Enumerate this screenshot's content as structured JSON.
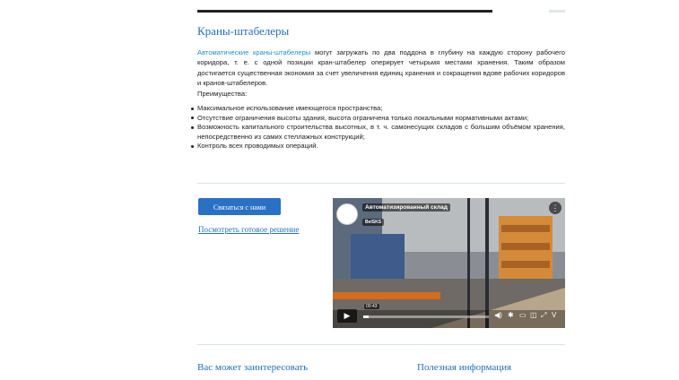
{
  "section": {
    "title": "Краны-штабелеры",
    "intro_link": "Автоматические краны-штабелеры",
    "intro_text": " могут загружать по два поддона в глубину на каждую сторону рабочего коридора, т. е. с одной позиции кран-штабелер оперирует четырьмя местами хранения. Таким образом достигается существенная экономия за счет увеличения единиц хранения и сокращения вдове рабочих коридоров и кранов-штабелеров.",
    "advantages_title": "Преимущества:",
    "advantages": [
      "Максимальное использование имеющегося пространства;",
      "Отсутствие ограничения высоты здания, высота ограничена только локальными нормативными актами;",
      "Возможность капитального строительства высотных, в т. ч. самонесущих складов с большим объёмом хранения, непосредственно из самих стеллажных конструкций;",
      "Контроль всех проводимых операций."
    ]
  },
  "cta": {
    "contact_label": "Связаться с нами",
    "solution_link": "Посмотреть готовое решение"
  },
  "video": {
    "title": "Автоматизированный склад",
    "channel": "BelSKS",
    "time": "00:43",
    "progress": 0.04
  },
  "bottom": {
    "left_heading": "Вас может заинтересовать",
    "right_heading": "Полезная информация"
  },
  "icons": [
    "play-icon",
    "volume-icon",
    "settings-icon",
    "captions-icon",
    "pip-icon",
    "fullscreen-icon",
    "vimeo-icon",
    "menu-icon"
  ]
}
